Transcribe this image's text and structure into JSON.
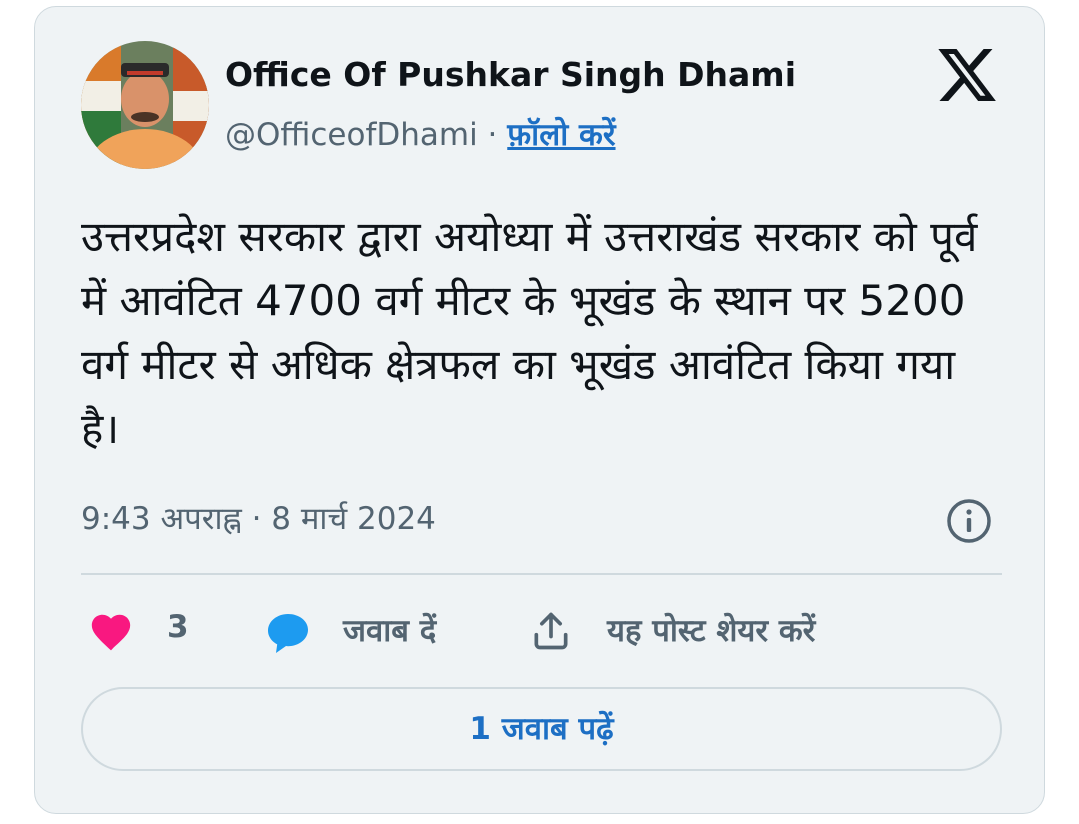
{
  "post": {
    "author_name": "Office Of Pushkar Singh Dhami",
    "handle": "@OfficeofDhami",
    "separator": " · ",
    "follow_label": "फ़ॉलो करें",
    "text": "उत्तरप्रदेश सरकार द्वारा अयोध्या में उत्तराखंड सरकार को पूर्व में आवंटित 4700 वर्ग मीटर के भूखंड के स्थान पर 5200 वर्ग मीटर से अधिक क्षेत्रफल का भूखंड आवंटित किया गया है।",
    "timestamp": "9:43 अपराह्न · 8 मार्च 2024"
  },
  "actions": {
    "like_count": "3",
    "reply_label": "जवाब दें",
    "share_label": "यह पोस्ट शेयर करें"
  },
  "read_replies_label": "1 जवाब पढ़ें",
  "icons": {
    "logo": "x-logo-icon",
    "info": "info-icon",
    "like": "heart-icon",
    "reply": "speech-bubble-icon",
    "share": "share-upload-icon"
  },
  "colors": {
    "card_bg": "#eff3f5",
    "link": "#1d6fc4",
    "heart": "#f91880",
    "reply_bubble": "#1d9bf0",
    "muted": "#536471"
  }
}
